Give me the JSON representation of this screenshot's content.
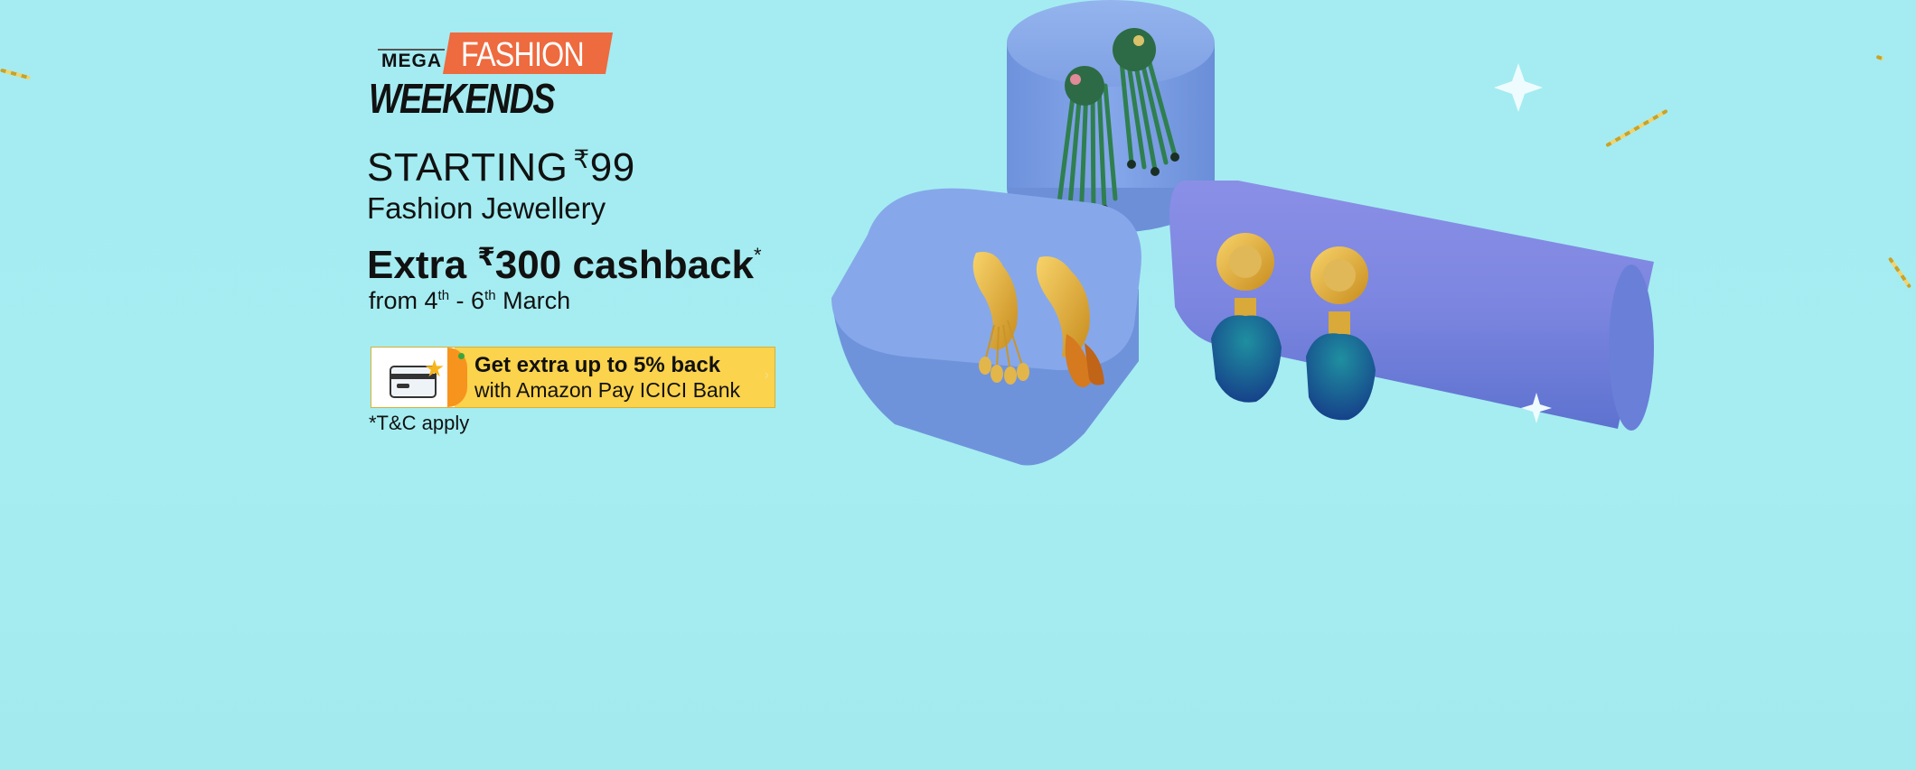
{
  "promo": {
    "logo": {
      "mega": "MEGA",
      "fashion": "FASHION",
      "weekends": "WEEKENDS"
    },
    "starting_label": "STARTING",
    "currency_symbol": "₹",
    "starting_price": "99",
    "category": "Fashion Jewellery",
    "cashback": {
      "prefix": "Extra",
      "amount": "300",
      "suffix": "cashback",
      "asterisk": "*"
    },
    "dates": {
      "from": "from 4",
      "sup1": "th",
      "mid": " - 6",
      "sup2": "th",
      "end": " March"
    },
    "offer_badge": {
      "line1": "Get extra up to 5% back",
      "line2": "with Amazon Pay ICICI Bank"
    },
    "tnc": "*T&C apply"
  },
  "colors": {
    "background": "#a4ecf1",
    "fashion_tag": "#ee6a3f",
    "offer_badge": "#fbd34c",
    "offer_accent": "#f7941d",
    "pedestal_blue": "#7fa4e6",
    "pedestal_violet": "#7d7fe0"
  },
  "icons": [
    "credit-card-icon",
    "star-icon",
    "sparkle-icon"
  ]
}
